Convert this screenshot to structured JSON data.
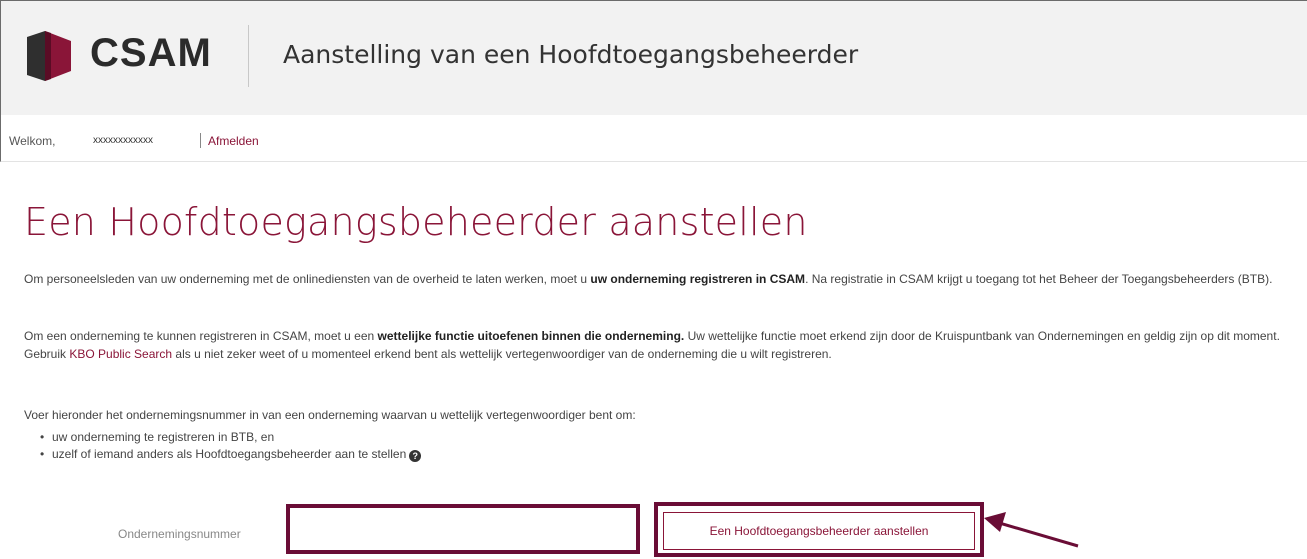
{
  "header": {
    "logo_text": "CSAM",
    "app_title": "Aanstelling van een Hoofdtoegangsbeheerder"
  },
  "userbar": {
    "welcome": "Welkom,",
    "username": "xxxxxxxxxxxx",
    "logout": "Afmelden"
  },
  "main": {
    "title": "Een Hoofdtoegangsbeheerder aanstellen",
    "p1_a": "Om personeelsleden van uw onderneming met de onlinediensten van de overheid te laten werken, moet u ",
    "p1_b": "uw onderneming registreren in CSAM",
    "p1_c": ". Na registratie in CSAM krijgt u toegang tot het Beheer der Toegangsbeheerders (BTB).",
    "p2_a": "Om een onderneming te kunnen registreren in CSAM, moet u een ",
    "p2_b": "wettelijke functie uitoefenen binnen die onderneming.",
    "p2_c": " Uw wettelijke functie moet erkend zijn door de Kruispuntbank van Ondernemingen en geldig zijn op dit moment. Gebruik ",
    "p2_link": "KBO Public Search",
    "p2_d": " als u niet zeker weet of u momenteel erkend bent als wettelijk vertegenwoordiger van de onderneming die u wilt registreren.",
    "p3": "Voer hieronder het ondernemingsnummer in van een onderneming waarvan u wettelijk vertegenwoordiger bent om:",
    "bullets": [
      "uw onderneming te registreren in BTB, en",
      "uzelf of iemand anders als Hoofdtoegangsbeheerder aan te stellen"
    ],
    "help_icon": "question-circle-icon"
  },
  "form": {
    "label": "Ondernemingsnummer",
    "input_value": "",
    "submit_label": "Een Hoofdtoegangsbeheerder aanstellen"
  },
  "colors": {
    "accent": "#8a1538",
    "highlight_box": "#6a0d36",
    "header_bg": "#f2f2f2"
  }
}
